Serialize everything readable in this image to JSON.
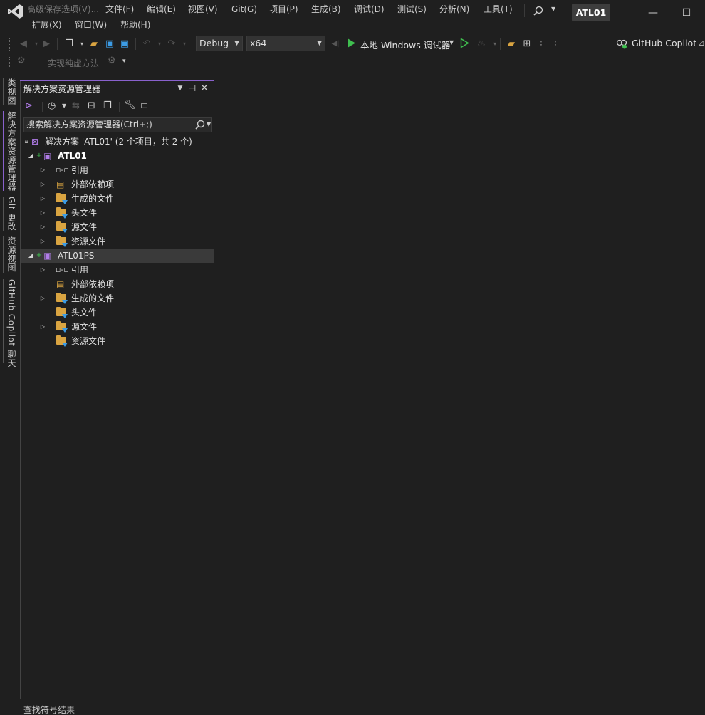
{
  "title_bar": {
    "search_hint": "高级保存选项(V)...",
    "menus_row1": [
      "文件(F)",
      "编辑(E)",
      "视图(V)",
      "Git(G)",
      "项目(P)",
      "生成(B)",
      "调试(D)",
      "测试(S)",
      "分析(N)",
      "工具(T)"
    ],
    "menus_row2": [
      "扩展(X)",
      "窗口(W)",
      "帮助(H)"
    ],
    "solution_badge": "ATL01",
    "minimize_glyph": "—",
    "maximize_glyph": "☐"
  },
  "toolbar": {
    "configuration": "Debug",
    "platform": "x64",
    "run_label": "本地 Windows 调试器",
    "copilot_label": "GitHub Copilot",
    "second_row_label": "实现纯虚方法"
  },
  "side_tabs": [
    "类视图",
    "解决方案资源管理器",
    "Git 更改",
    "资源视图",
    "GitHub Copilot 聊天"
  ],
  "panel": {
    "title": "解决方案资源管理器",
    "search_placeholder": "搜索解决方案资源管理器(Ctrl+;)",
    "tree": {
      "solution": "解决方案 'ATL01' (2 个项目，共 2 个)",
      "project1": {
        "name": "ATL01",
        "items": [
          "引用",
          "外部依赖项",
          "生成的文件",
          "头文件",
          "源文件",
          "资源文件"
        ]
      },
      "project2": {
        "name": "ATL01PS",
        "items": [
          "引用",
          "外部依赖项",
          "生成的文件",
          "头文件",
          "源文件",
          "资源文件"
        ]
      }
    }
  },
  "bottom_tab": "查找符号结果",
  "colors": {
    "background": "#1f1f1f",
    "accent": "#8961cc",
    "run_green": "#3fbf4f",
    "folder": "#d9a441",
    "selection": "#3a3a3a"
  }
}
